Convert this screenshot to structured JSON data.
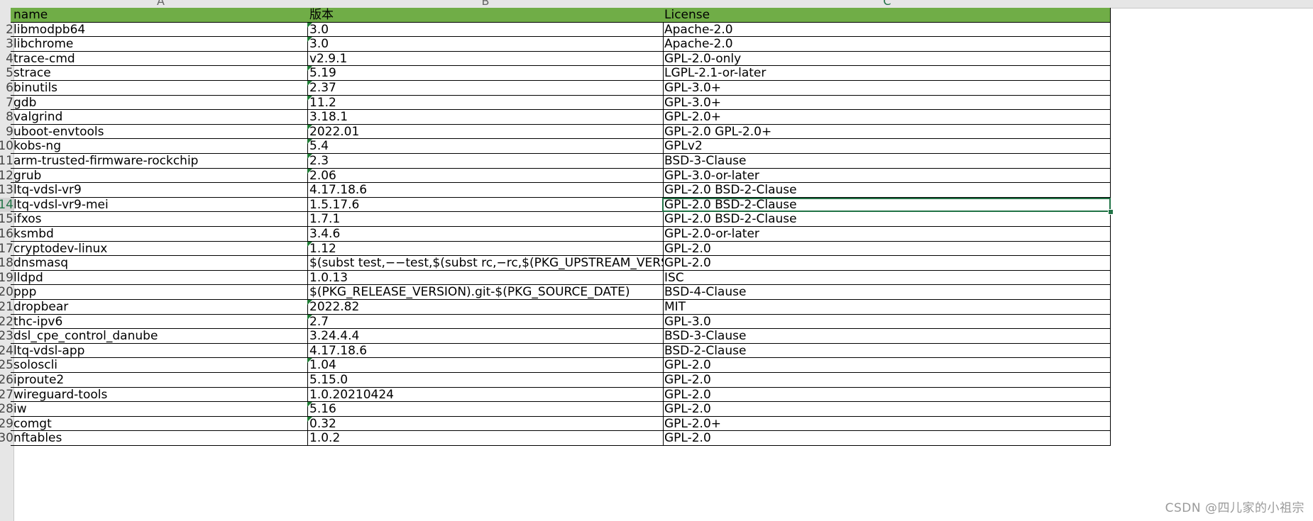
{
  "columns": [
    "A",
    "B",
    "C"
  ],
  "active_column": "C",
  "header_row": {
    "row": "",
    "name": "name",
    "version": "版本",
    "license": "License"
  },
  "rows": [
    {
      "row": "2",
      "name": "libmodpb64",
      "version": "3.0",
      "license": "Apache-2.0",
      "tri": true
    },
    {
      "row": "3",
      "name": "libchrome",
      "version": "3.0",
      "license": "Apache-2.0",
      "tri": true
    },
    {
      "row": "4",
      "name": "trace-cmd",
      "version": "v2.9.1",
      "license": "GPL-2.0-only",
      "tri": false
    },
    {
      "row": "5",
      "name": "strace",
      "version": "5.19",
      "license": "LGPL-2.1-or-later",
      "tri": true
    },
    {
      "row": "6",
      "name": "binutils",
      "version": "2.37",
      "license": "GPL-3.0+",
      "tri": true
    },
    {
      "row": "7",
      "name": "gdb",
      "version": "11.2",
      "license": "GPL-3.0+",
      "tri": true
    },
    {
      "row": "8",
      "name": "valgrind",
      "version": "3.18.1",
      "license": "GPL-2.0+",
      "tri": false
    },
    {
      "row": "9",
      "name": "uboot-envtools",
      "version": "2022.01",
      "license": "GPL-2.0 GPL-2.0+",
      "tri": true
    },
    {
      "row": "10",
      "name": "kobs-ng",
      "version": "5.4",
      "license": "GPLv2",
      "tri": true
    },
    {
      "row": "11",
      "name": "arm-trusted-firmware-rockchip",
      "version": "2.3",
      "license": "BSD-3-Clause",
      "tri": true
    },
    {
      "row": "12",
      "name": "grub",
      "version": "2.06",
      "license": "GPL-3.0-or-later",
      "tri": true
    },
    {
      "row": "13",
      "name": "ltq-vdsl-vr9",
      "version": "4.17.18.6",
      "license": "GPL-2.0 BSD-2-Clause",
      "tri": false
    },
    {
      "row": "14",
      "name": "ltq-vdsl-vr9-mei",
      "version": "1.5.17.6",
      "license": "GPL-2.0 BSD-2-Clause",
      "tri": false,
      "selected": true
    },
    {
      "row": "15",
      "name": "ifxos",
      "version": "1.7.1",
      "license": "GPL-2.0 BSD-2-Clause",
      "tri": false
    },
    {
      "row": "16",
      "name": "ksmbd",
      "version": "3.4.6",
      "license": "GPL-2.0-or-later",
      "tri": false
    },
    {
      "row": "17",
      "name": "cryptodev-linux",
      "version": "1.12",
      "license": "GPL-2.0",
      "tri": true
    },
    {
      "row": "18",
      "name": "dnsmasq",
      "version": "$(subst test,−−test,$(subst rc,−rc,$(PKG_UPSTREAM_VERSION)))",
      "license": "GPL-2.0",
      "tri": false
    },
    {
      "row": "19",
      "name": "lldpd",
      "version": "1.0.13",
      "license": "ISC",
      "tri": false
    },
    {
      "row": "20",
      "name": "ppp",
      "version": "$(PKG_RELEASE_VERSION).git-$(PKG_SOURCE_DATE)",
      "license": "BSD-4-Clause",
      "tri": false
    },
    {
      "row": "21",
      "name": "dropbear",
      "version": "2022.82",
      "license": "MIT",
      "tri": true
    },
    {
      "row": "22",
      "name": "thc-ipv6",
      "version": "2.7",
      "license": "GPL-3.0",
      "tri": true
    },
    {
      "row": "23",
      "name": "dsl_cpe_control_danube",
      "version": "3.24.4.4",
      "license": "BSD-3-Clause",
      "tri": false
    },
    {
      "row": "24",
      "name": "ltq-vdsl-app",
      "version": "4.17.18.6",
      "license": "BSD-2-Clause",
      "tri": false
    },
    {
      "row": "25",
      "name": "soloscli",
      "version": "1.04",
      "license": "GPL-2.0",
      "tri": true
    },
    {
      "row": "26",
      "name": "iproute2",
      "version": "5.15.0",
      "license": "GPL-2.0",
      "tri": false
    },
    {
      "row": "27",
      "name": "wireguard-tools",
      "version": "1.0.20210424",
      "license": "GPL-2.0",
      "tri": false
    },
    {
      "row": "28",
      "name": "iw",
      "version": "5.16",
      "license": "GPL-2.0",
      "tri": true
    },
    {
      "row": "29",
      "name": "comgt",
      "version": "0.32",
      "license": "GPL-2.0+",
      "tri": true
    },
    {
      "row": "30",
      "name": "nftables",
      "version": "1.0.2",
      "license": "GPL-2.0",
      "tri": false
    }
  ],
  "watermark": "CSDN @四儿家的小祖宗",
  "colors": {
    "header_fill": "#70ad47",
    "selection": "#217346",
    "comment_marker": "#1e7b34"
  }
}
